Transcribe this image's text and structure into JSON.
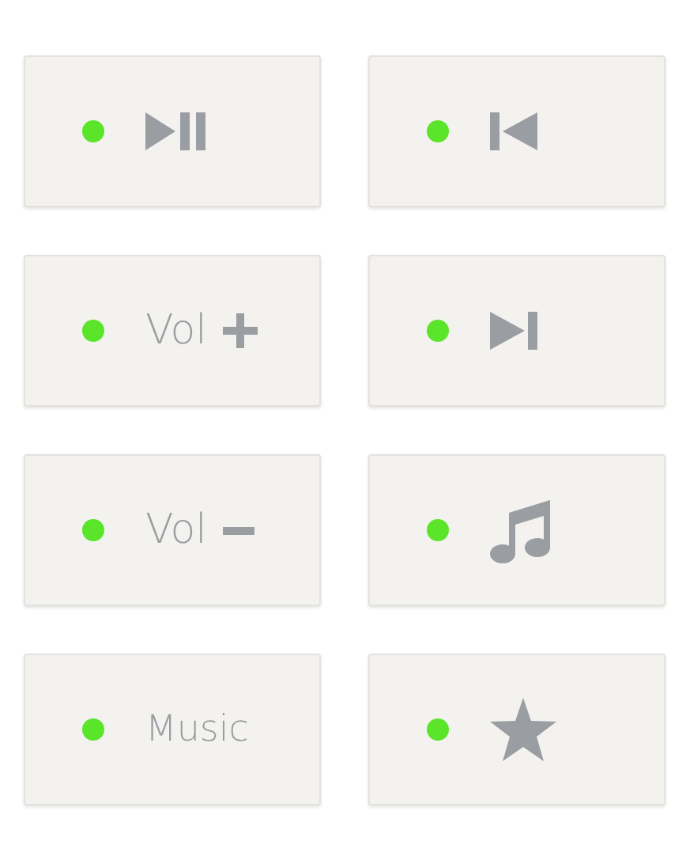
{
  "buttons": [
    {
      "kind": "play_pause",
      "led_on": true
    },
    {
      "kind": "previous",
      "led_on": true
    },
    {
      "kind": "vol_up",
      "label": "Vol",
      "led_on": true
    },
    {
      "kind": "next",
      "led_on": true
    },
    {
      "kind": "vol_down",
      "label": "Vol",
      "led_on": true
    },
    {
      "kind": "music",
      "led_on": true
    },
    {
      "kind": "text",
      "label": "Music",
      "led_on": true
    },
    {
      "kind": "star",
      "led_on": true
    }
  ]
}
